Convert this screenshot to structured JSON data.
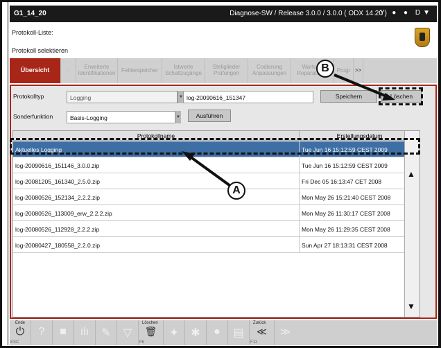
{
  "window": {
    "title_left": "G1_14_20",
    "title_right": "Diagnose-SW / Release 3.0.0 / 3.0.0  ( ODX  14.20 )",
    "title_icons": "Y ● ●  D▼"
  },
  "header": {
    "line1": "Protokoll-Liste:",
    "line2": "Protokoll selektieren"
  },
  "tabs": [
    {
      "label": "Übersicht"
    },
    {
      "label": "·"
    },
    {
      "label": "Erweiterte Identifikationen"
    },
    {
      "label": "Fehlerspeicher"
    },
    {
      "label": "Istwerte Schaltzugänge"
    },
    {
      "label": "Stellglieder Prüfungen"
    },
    {
      "label": "Codierung Anpassungen"
    },
    {
      "label": "Wartung Reparaturen"
    },
    {
      "label": "Progr"
    },
    {
      "label": ">>"
    }
  ],
  "form": {
    "protokolltyp_label": "Protokolltyp",
    "protokolltyp_value": "Logging",
    "filename_value": "log-20090616_151347",
    "speichern_label": "Speichern",
    "loeschen_label": "Löschen",
    "sonderfunktion_label": "Sonderfunktion",
    "sonderfunktion_value": "Basis-Logging",
    "ausfuehren_label": "Ausführen"
  },
  "table": {
    "columns": [
      "Protokollname",
      "Erstellungsdatum"
    ],
    "rows": [
      {
        "name": "Aktuelles Logging",
        "date": "Tue Jun 16 15:12:59 CEST 2009",
        "selected": true
      },
      {
        "name": "log-20090616_151146_3.0.0.zip",
        "date": "Tue Jun 16 15:12:59 CEST 2009"
      },
      {
        "name": "log-20081205_161340_2.5.0.zip",
        "date": "Fri Dec 05 16:13:47 CET 2008"
      },
      {
        "name": "log-20080526_152134_2.2.2.zip",
        "date": "Mon May 26 15:21:40 CEST 2008"
      },
      {
        "name": "log-20080526_113009_erw_2.2.2.zip",
        "date": "Mon May 26 11:30:17 CEST 2008"
      },
      {
        "name": "log-20080526_112928_2.2.2.zip",
        "date": "Mon May 26 11:29:35 CEST 2008"
      },
      {
        "name": "log-20080427_180558_2.2.0.zip",
        "date": "Sun Apr 27 18:13:31 CEST 2008"
      }
    ]
  },
  "bottombar": {
    "ende_label": "Ende",
    "ende_key": "ESC",
    "loeschen_label": "Löschen",
    "loeschen_key": "F6",
    "zurueck_label": "Zurück",
    "zurueck_key": "F11"
  },
  "callouts": {
    "a": "A",
    "b": "B"
  },
  "colors": {
    "accent": "#a82618",
    "selection": "#3d6ea4"
  }
}
